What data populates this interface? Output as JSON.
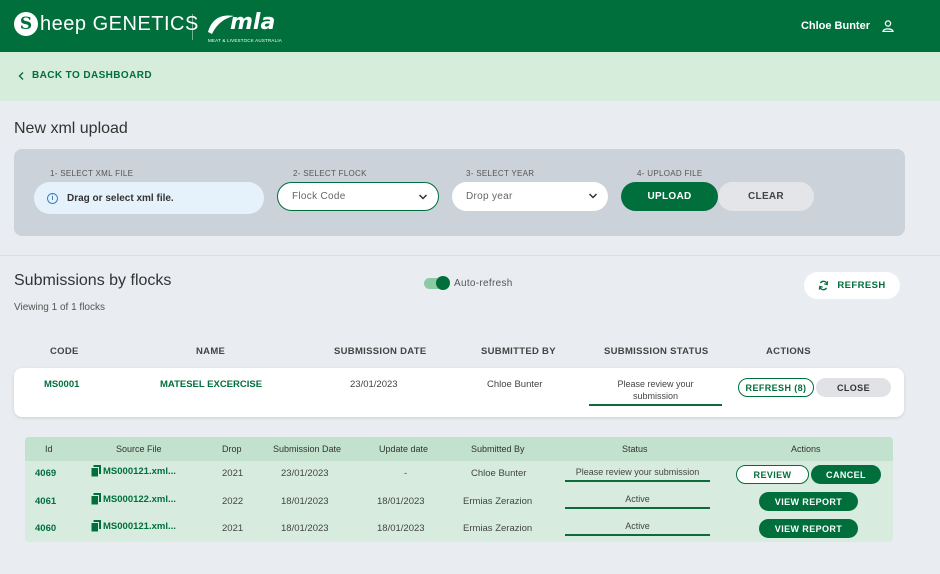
{
  "header": {
    "logo_letter": "S",
    "logo_text_main": "heep",
    "logo_text_secondary": "GENETICS",
    "partner_logo_word": "mla",
    "partner_logo_sub": "MEAT & LIVESTOCK AUSTRALIA",
    "user_name": "Chloe Bunter"
  },
  "nav": {
    "back_label": "BACK TO DASHBOARD"
  },
  "page": {
    "title": "New xml upload"
  },
  "upload": {
    "step1_label": "1- SELECT XML FILE",
    "step2_label": "2- SELECT FLOCK",
    "step3_label": "3- SELECT YEAR",
    "step4_label": "4- UPLOAD FILE",
    "drop_text": "Drag or select xml file.",
    "flock_placeholder": "Flock Code",
    "year_placeholder": "Drop year",
    "upload_label": "UPLOAD",
    "clear_label": "CLEAR"
  },
  "submissions": {
    "title": "Submissions by flocks",
    "viewing": "Viewing 1 of 1 flocks",
    "auto_refresh_label": "Auto-refresh",
    "auto_refresh_on": true,
    "refresh_label": "REFRESH",
    "columns": [
      "CODE",
      "NAME",
      "SUBMISSION DATE",
      "SUBMITTED BY",
      "SUBMISSION STATUS",
      "ACTIONS"
    ],
    "flock": {
      "code": "MS0001",
      "name": "MATESEL EXCERCISE",
      "date": "23/01/2023",
      "submitted_by": "Chloe Bunter",
      "status_line1": "Please review your",
      "status_line2": "submission",
      "refresh_action": "REFRESH (8)",
      "close_action": "CLOSE"
    }
  },
  "detail": {
    "columns": [
      "Id",
      "Source File",
      "Drop",
      "Submission Date",
      "Update date",
      "Submitted By",
      "Status",
      "Actions"
    ],
    "rows": [
      {
        "id": "4069",
        "file": "MS000121.xml...",
        "drop": "2021",
        "submission_date": "23/01/2023",
        "update_date": "-",
        "submitted_by": "Chloe Bunter",
        "status": "Please review your submission",
        "action1": "REVIEW",
        "action2": "CANCEL"
      },
      {
        "id": "4061",
        "file": "MS000122.xml...",
        "drop": "2022",
        "submission_date": "18/01/2023",
        "update_date": "18/01/2023",
        "submitted_by": "Ermias Zerazion",
        "status": "Active",
        "action1": "VIEW REPORT"
      },
      {
        "id": "4060",
        "file": "MS000121.xml...",
        "drop": "2021",
        "submission_date": "18/01/2023",
        "update_date": "18/01/2023",
        "submitted_by": "Ermias Zerazion",
        "status": "Active",
        "action1": "VIEW REPORT"
      }
    ]
  },
  "colors": {
    "brand_green": "#006f3c",
    "back_bar": "#d6eddc",
    "panel": "#ccd2d9",
    "table_bg": "#d7ecdf"
  }
}
